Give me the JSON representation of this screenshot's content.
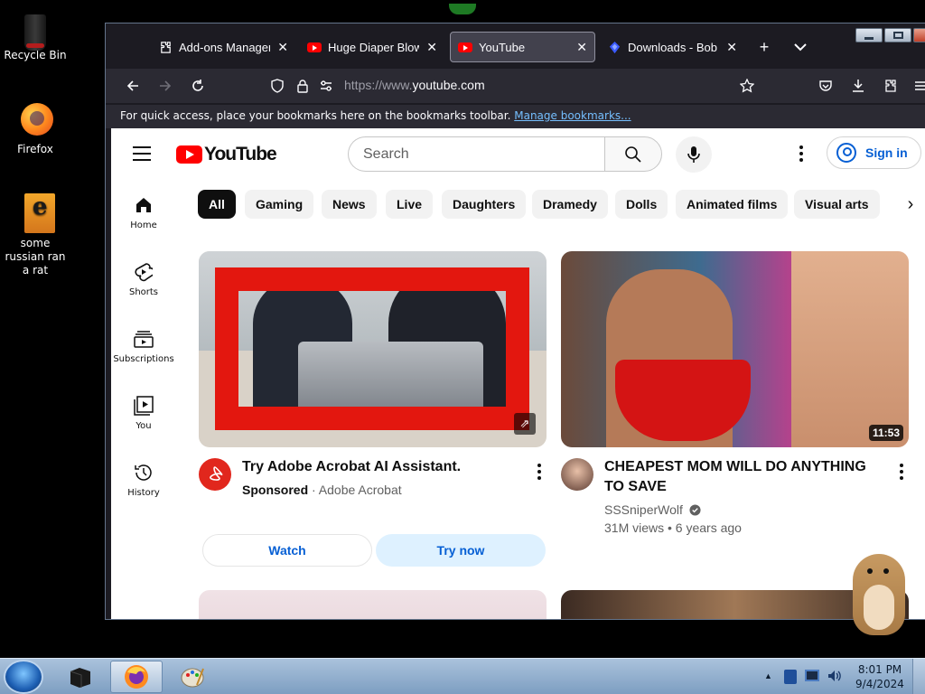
{
  "desktop": {
    "icons": [
      {
        "label": "Recycle Bin",
        "icon": "recycle-bin-icon"
      },
      {
        "label": "Firefox",
        "icon": "firefox-icon"
      },
      {
        "label": "some russian ran a rat",
        "icon": "rat-program-icon"
      }
    ]
  },
  "browser": {
    "tabs": [
      {
        "title": "Add-ons Manager",
        "icon": "puzzle-icon",
        "active": false
      },
      {
        "title": "Huge Diaper Blowout",
        "icon": "youtube-icon",
        "active": false
      },
      {
        "title": "YouTube",
        "icon": "youtube-icon",
        "active": true
      },
      {
        "title": "Downloads - Bob Po",
        "icon": "downloads-icon",
        "active": false
      }
    ],
    "url_prefix": "https://www.",
    "url_host": "youtube.com",
    "bookmarks_text": "For quick access, place your bookmarks here on the bookmarks toolbar.",
    "bookmarks_link": "Manage bookmarks..."
  },
  "youtube": {
    "logo_text": "YouTube",
    "search_placeholder": "Search",
    "sign_in": "Sign in",
    "sidebar": [
      {
        "label": "Home",
        "icon": "home-icon"
      },
      {
        "label": "Shorts",
        "icon": "shorts-icon"
      },
      {
        "label": "Subscriptions",
        "icon": "subscriptions-icon"
      },
      {
        "label": "You",
        "icon": "you-icon"
      },
      {
        "label": "History",
        "icon": "history-icon"
      }
    ],
    "chips": [
      "All",
      "Gaming",
      "News",
      "Live",
      "Daughters",
      "Dramedy",
      "Dolls",
      "Animated films",
      "Visual arts"
    ],
    "ad": {
      "title": "Try Adobe Acrobat AI Assistant.",
      "sponsored": "Sponsored",
      "advertiser": "Adobe Acrobat",
      "watch": "Watch",
      "try_now": "Try now"
    },
    "video": {
      "title": "CHEAPEST MOM WILL DO ANYTHING TO SAVE",
      "channel": "SSSniperWolf",
      "stats": "31M views • 6 years ago",
      "duration": "11:53"
    }
  },
  "taskbar": {
    "time": "8:01 PM",
    "date": "9/4/2024"
  },
  "colors": {
    "accent": "#065fd4",
    "yt_red": "#ff0000",
    "browser_bg": "#1c1b22",
    "toolbar_bg": "#2b2a33"
  }
}
